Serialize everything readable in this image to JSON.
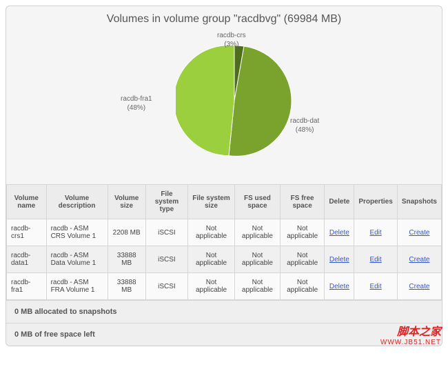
{
  "title": "Volumes in volume group \"racdbvg\" (69984 MB)",
  "chart_data": {
    "type": "pie",
    "slices": [
      {
        "name": "racdb-crs",
        "pct": 3,
        "color": "#4d6e1a"
      },
      {
        "name": "racdb-dat",
        "pct": 48,
        "color": "#79a32c"
      },
      {
        "name": "racdb-fra1",
        "pct": 48,
        "color": "#9ccf3e"
      }
    ],
    "labels": {
      "crs": "racdb-crs\n(3%)",
      "dat": "racdb-dat\n(48%)",
      "fra": "racdb-fra1\n(48%)"
    }
  },
  "headers": [
    "Volume name",
    "Volume description",
    "Volume size",
    "File system type",
    "File system size",
    "FS used space",
    "FS free space",
    "Delete",
    "Properties",
    "Snapshots"
  ],
  "rows": [
    {
      "name": "racdb-crs1",
      "desc": "racdb - ASM CRS Volume 1",
      "size": "2208 MB",
      "fstype": "iSCSI",
      "fssize": "Not applicable",
      "used": "Not applicable",
      "free": "Not applicable",
      "del": "Delete",
      "prop": "Edit",
      "snap": "Create"
    },
    {
      "name": "racdb-data1",
      "desc": "racdb - ASM Data Volume 1",
      "size": "33888 MB",
      "fstype": "iSCSI",
      "fssize": "Not applicable",
      "used": "Not applicable",
      "free": "Not applicable",
      "del": "Delete",
      "prop": "Edit",
      "snap": "Create"
    },
    {
      "name": "racdb-fra1",
      "desc": "racdb - ASM FRA Volume 1",
      "size": "33888 MB",
      "fstype": "iSCSI",
      "fssize": "Not applicable",
      "used": "Not applicable",
      "free": "Not applicable",
      "del": "Delete",
      "prop": "Edit",
      "snap": "Create"
    }
  ],
  "footer1": "0 MB allocated to snapshots",
  "footer2": "0 MB of free space left",
  "watermark": {
    "line1": "脚本之家",
    "line2": "WWW.JB51.NET"
  }
}
